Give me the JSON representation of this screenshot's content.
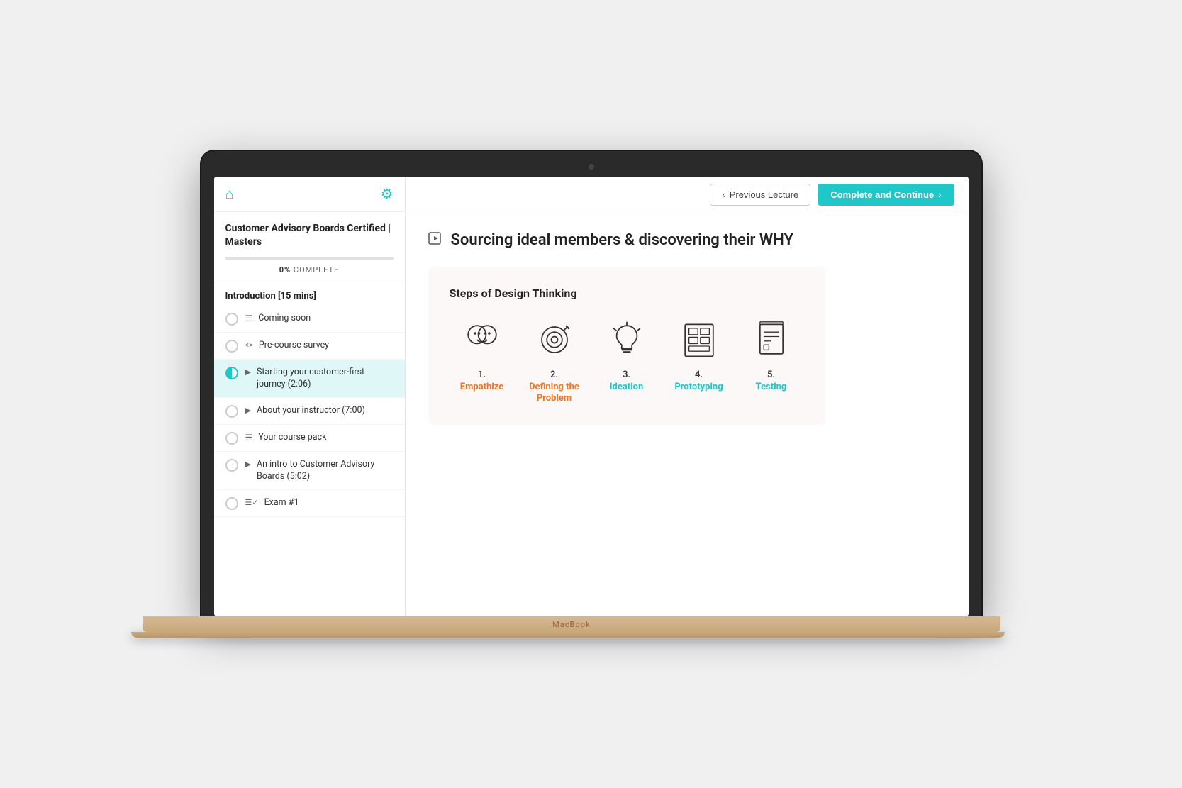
{
  "app": {
    "laptop_brand": "MacBook"
  },
  "sidebar": {
    "course_title": "Customer Advisory Boards Certified | Masters",
    "progress_percent": "0%",
    "progress_label": "COMPLETE",
    "section_title": "Introduction [15 mins]",
    "curriculum_items": [
      {
        "id": 1,
        "icon": "lines",
        "text": "Coming soon",
        "active": false,
        "circle": "empty"
      },
      {
        "id": 2,
        "icon": "code",
        "text": "Pre-course survey",
        "active": false,
        "circle": "empty"
      },
      {
        "id": 3,
        "icon": "video",
        "text": "Starting your customer-first journey (2:06)",
        "active": true,
        "circle": "half"
      },
      {
        "id": 4,
        "icon": "video",
        "text": "About your instructor (7:00)",
        "active": false,
        "circle": "empty"
      },
      {
        "id": 5,
        "icon": "lines",
        "text": "Your course pack",
        "active": false,
        "circle": "empty"
      },
      {
        "id": 6,
        "icon": "video",
        "text": "An intro to Customer Advisory Boards (5:02)",
        "active": false,
        "circle": "empty"
      },
      {
        "id": 7,
        "icon": "exam",
        "text": "Exam #1",
        "active": false,
        "circle": "empty"
      }
    ]
  },
  "topbar": {
    "prev_button": "Previous Lecture",
    "complete_button": "Complete and Continue",
    "prev_arrow": "‹",
    "next_arrow": "›"
  },
  "content": {
    "lecture_title": "Sourcing ideal members & discovering their WHY",
    "design_thinking": {
      "section_title": "Steps of Design Thinking",
      "steps": [
        {
          "number": "1.",
          "label": "Empathize",
          "color": "orange"
        },
        {
          "number": "2.",
          "label": "Defining the Problem",
          "color": "orange"
        },
        {
          "number": "3.",
          "label": "Ideation",
          "color": "teal"
        },
        {
          "number": "4.",
          "label": "Prototyping",
          "color": "teal"
        },
        {
          "number": "5.",
          "label": "Testing",
          "color": "teal"
        }
      ]
    }
  }
}
